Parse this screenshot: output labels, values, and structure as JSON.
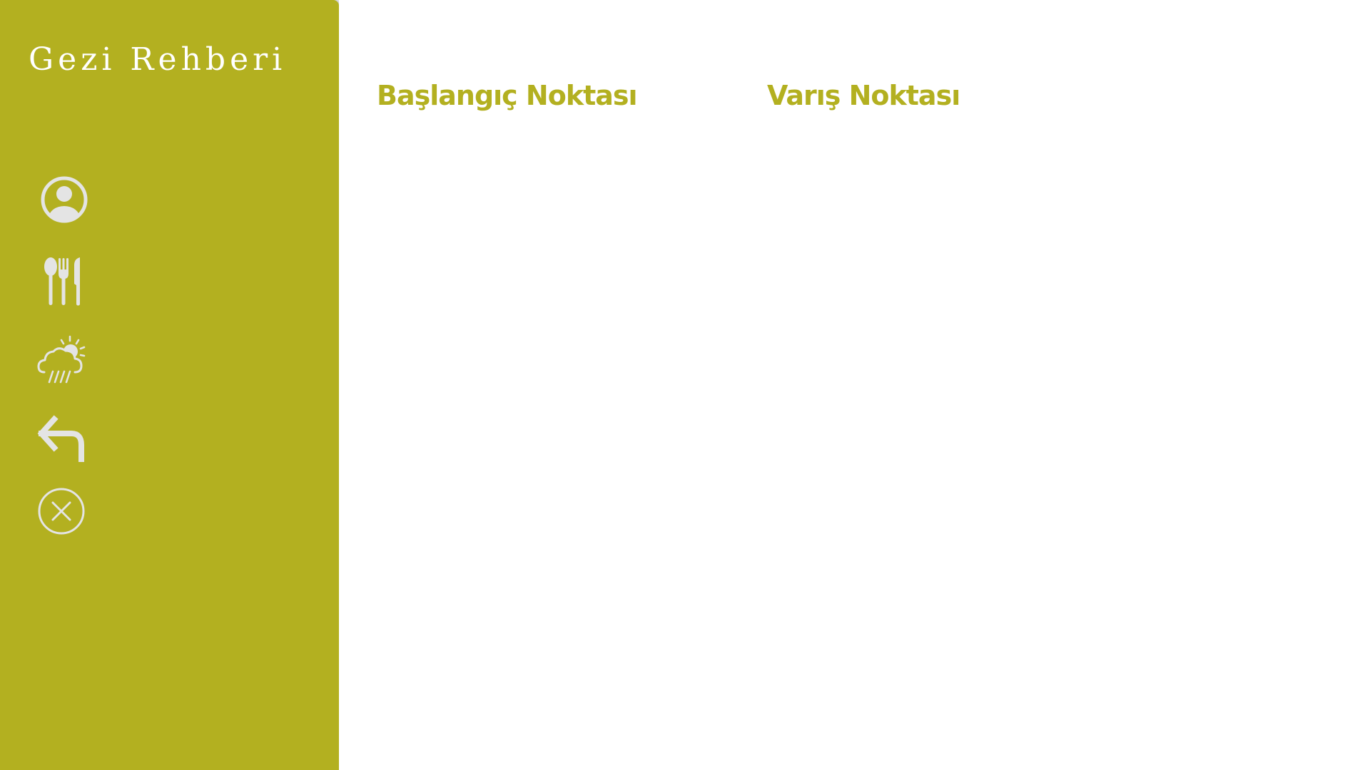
{
  "app": {
    "title": "Gezi Rehberi"
  },
  "theme": {
    "accent": "#b3b020",
    "icon_color": "#e4e4e4",
    "background": "#ffffff"
  },
  "sidebar": {
    "items": [
      {
        "name": "profile",
        "icon": "user-circle-icon"
      },
      {
        "name": "restaurants",
        "icon": "utensils-icon"
      },
      {
        "name": "weather",
        "icon": "weather-rain-sun-icon"
      },
      {
        "name": "back",
        "icon": "back-arrow-icon"
      },
      {
        "name": "exit",
        "icon": "close-circle-icon"
      }
    ]
  },
  "main": {
    "start_label": "Başlangıç Noktası",
    "end_label": "Varış Noktası"
  }
}
